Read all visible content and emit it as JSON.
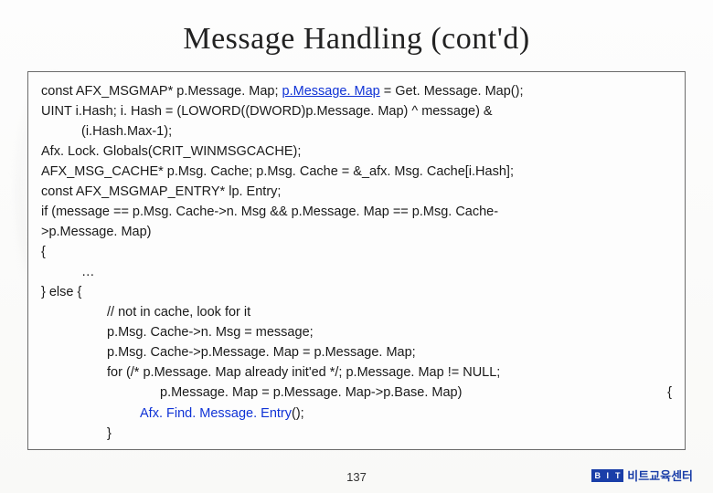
{
  "title": "Message Handling (cont'd)",
  "code": {
    "l1a": "const AFX_MSGMAP* p.Message. Map; ",
    "l1b": "p.Message. Map",
    "l1c": " = Get. Message. Map();",
    "l2": "UINT i.Hash; i. Hash = (LOWORD((DWORD)p.Message. Map) ^ message) &",
    "l3": "(i.Hash.Max-1);",
    "l4": "Afx. Lock. Globals(CRIT_WINMSGCACHE);",
    "l5": "AFX_MSG_CACHE* p.Msg. Cache; p.Msg. Cache = &_afx. Msg. Cache[i.Hash];",
    "l6": "const AFX_MSGMAP_ENTRY* lp. Entry;",
    "l7": "if (message == p.Msg. Cache->n. Msg && p.Message. Map == p.Msg. Cache-",
    "l8": ">p.Message. Map)",
    "l9": "{",
    "l10": "…",
    "l11": "} else {",
    "l12": "// not in cache, look for it",
    "l13": "p.Msg. Cache->n. Msg = message;",
    "l14": "p.Msg. Cache->p.Message. Map = p.Message. Map;",
    "l15": "for (/* p.Message. Map already init'ed */; p.Message. Map != NULL;",
    "l16left": "p.Message. Map = p.Message. Map->p.Base. Map)",
    "l16right": "{",
    "l17": "Afx. Find. Message. Entry",
    "l17b": "();",
    "l18": "}"
  },
  "page_number": "137",
  "footer": {
    "logo_chars": [
      "B",
      "I",
      "T"
    ],
    "text": "비트교육센터"
  }
}
